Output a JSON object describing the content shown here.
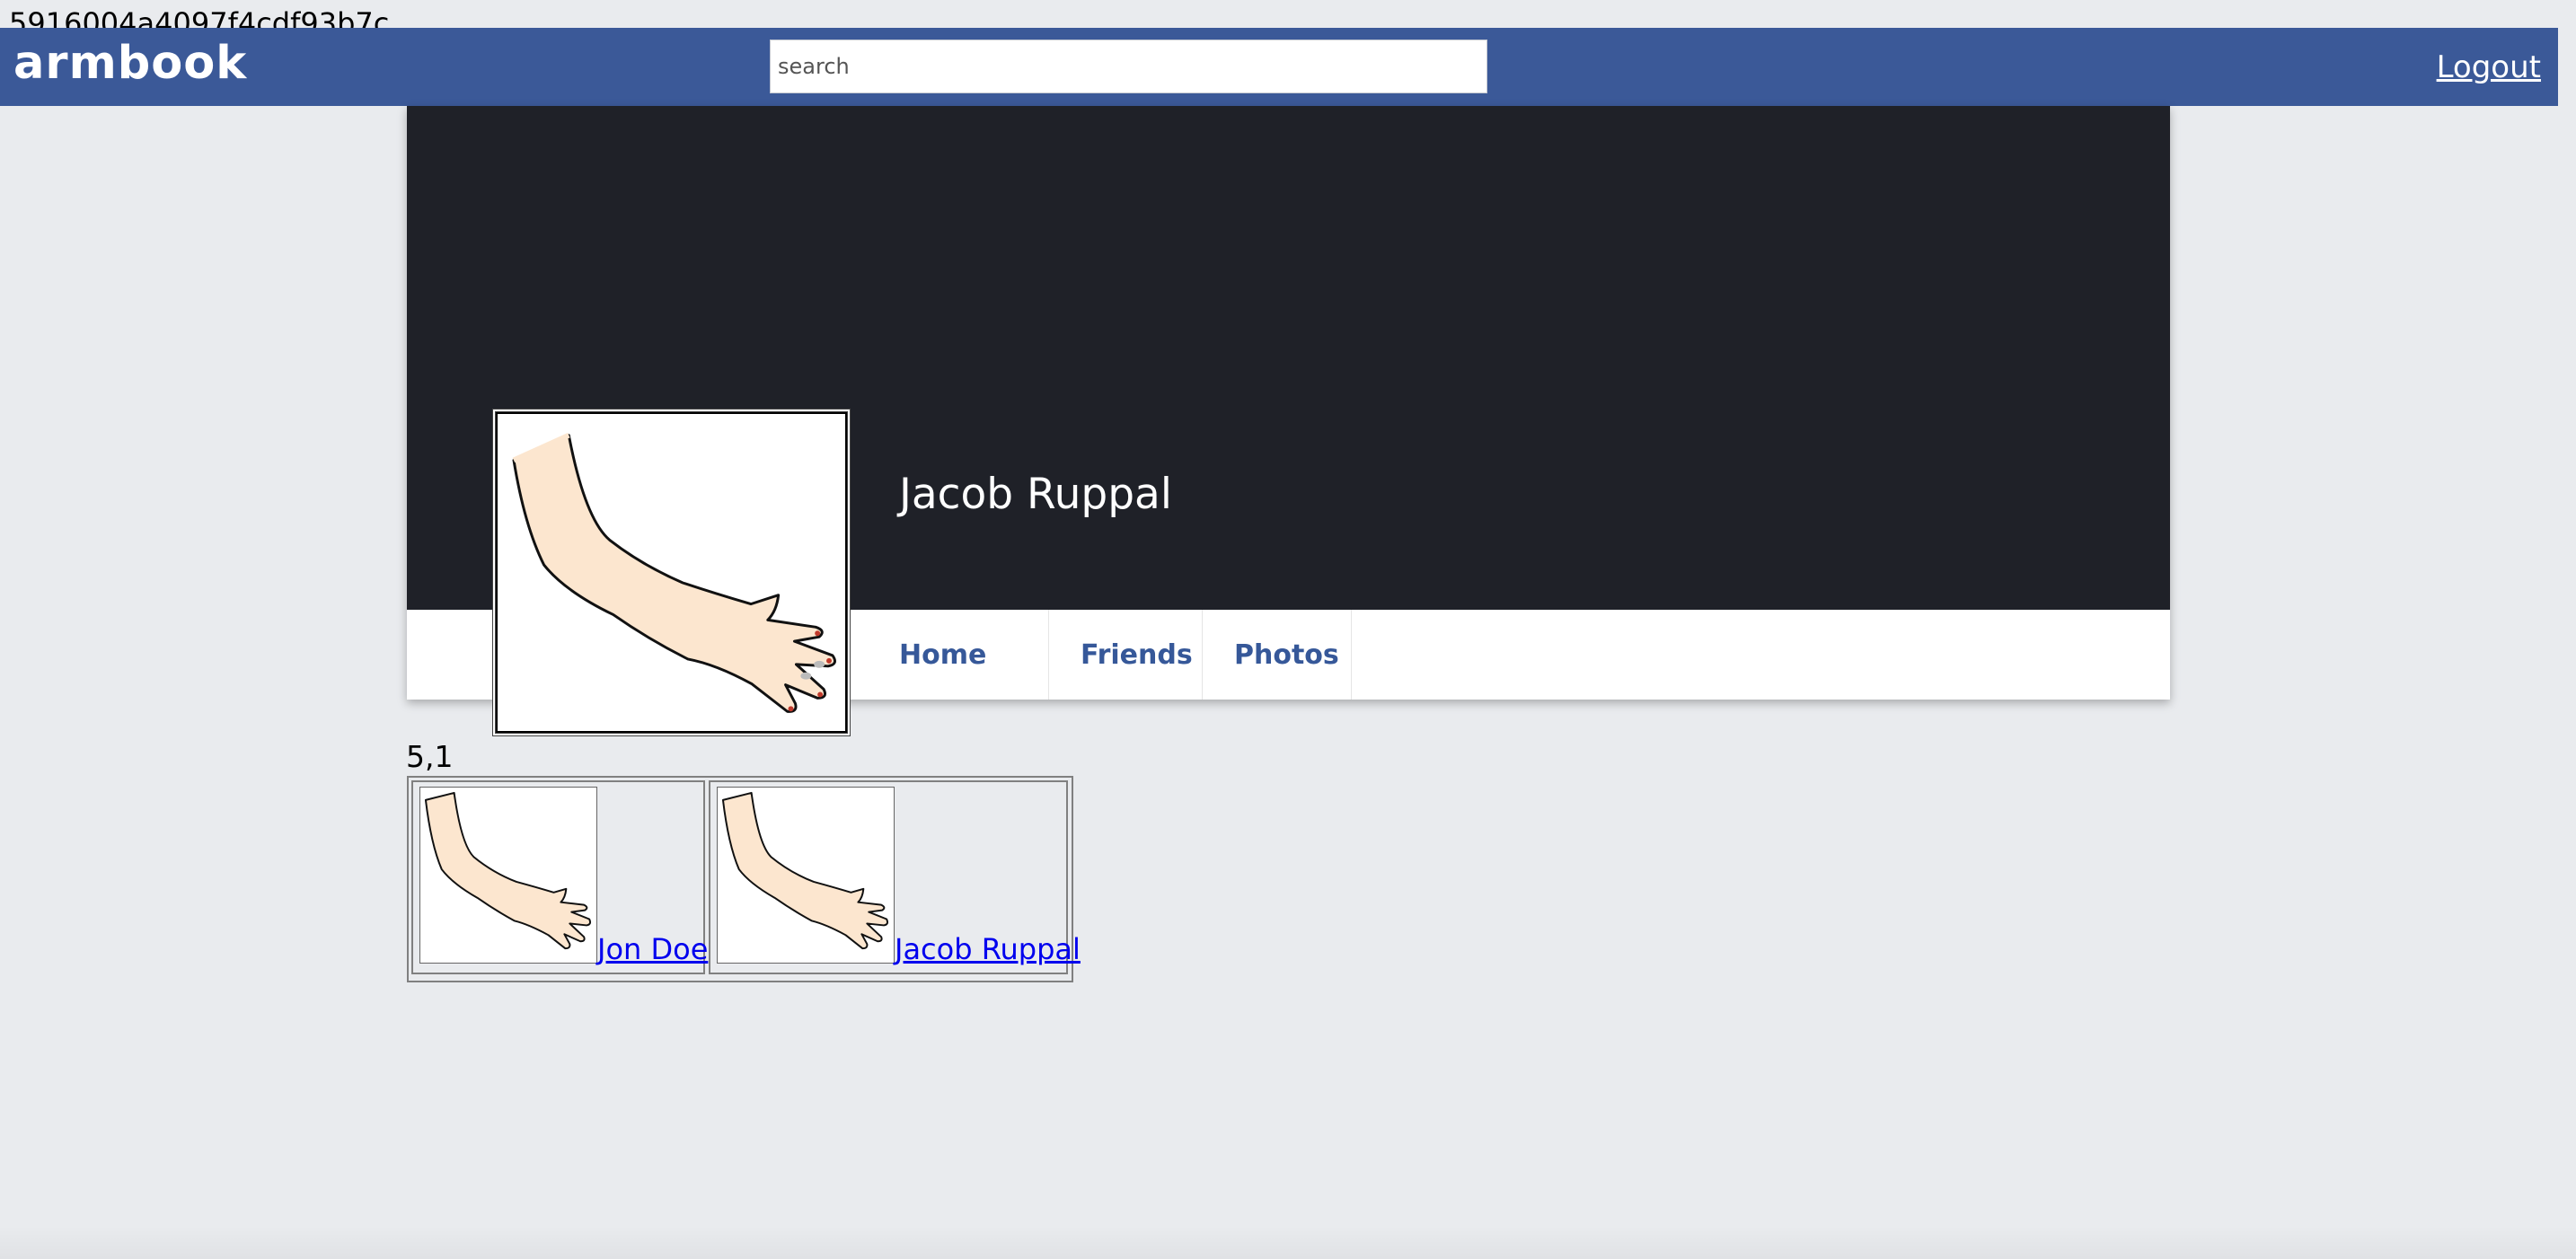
{
  "debug": {
    "hash": "5916004a4097f4cdf93b7c"
  },
  "topbar": {
    "brand": "armbook",
    "search_placeholder": "search",
    "search_value": "",
    "logout_label": "Logout"
  },
  "profile": {
    "name": "Jacob Ruppal",
    "tabs": [
      {
        "label": "Home"
      },
      {
        "label": "Friends"
      },
      {
        "label": "Photos"
      }
    ]
  },
  "friends": {
    "count_text": "5,1",
    "items": [
      {
        "name": "Jon Doe"
      },
      {
        "name": "Jacob Ruppal"
      }
    ]
  },
  "colors": {
    "topbar": "#3b5998",
    "cover": "#1f2128",
    "page_background": "#e9ebee",
    "nav_link": "#365899",
    "friend_link": "#0000ee"
  }
}
